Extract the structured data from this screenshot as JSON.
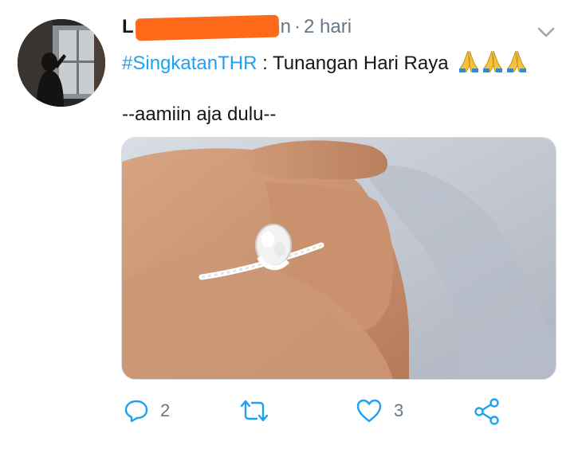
{
  "tweet": {
    "name_start": "L",
    "name_end": "n",
    "separator": "·",
    "time": "2 hari",
    "hashtag": "#SingkatanTHR",
    "text_after_hashtag": " : Tunangan Hari Raya",
    "emoji": "folded-hands x3",
    "second_line": "--aamiin aja dulu--"
  },
  "actions": {
    "reply_count": "2",
    "like_count": "3"
  },
  "icons": [
    "chevron-down-icon",
    "reply-icon",
    "retweet-icon",
    "like-icon",
    "share-icon"
  ],
  "colors": {
    "accent": "#1da1f2",
    "muted": "#657786",
    "redaction": "#ff6a1a"
  }
}
